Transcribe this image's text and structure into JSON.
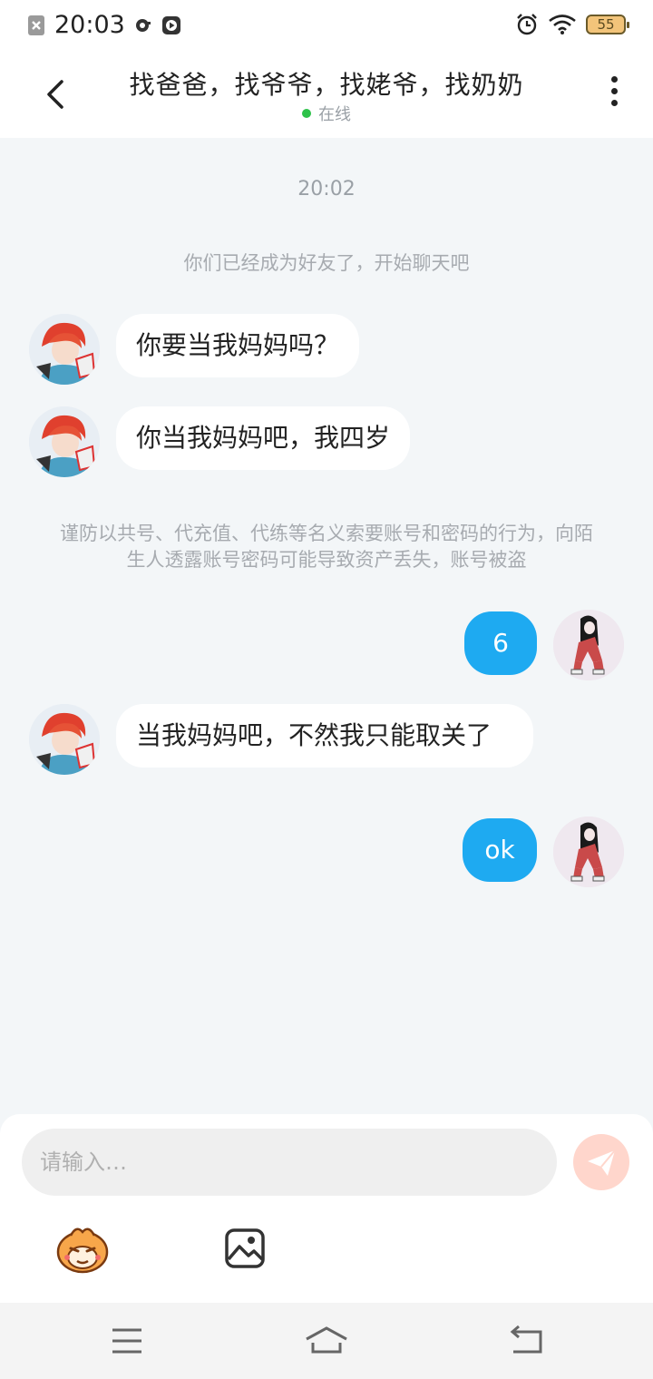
{
  "status_bar": {
    "time": "20:03",
    "battery": "55",
    "icons": [
      "notification-close-icon",
      "headset-icon",
      "media-play-icon",
      "alarm-icon",
      "wifi-icon",
      "battery-icon"
    ]
  },
  "header": {
    "title": "找爸爸，找爷爷，找姥爷，找奶奶",
    "status": "在线",
    "back_icon": "back-arrow-icon",
    "more_icon": "more-vertical-icon"
  },
  "chat": {
    "timestamp": "20:02",
    "system_note": "你们已经成为好友了，开始聊天吧",
    "warning_note": "谨防以共号、代充值、代练等名义索要账号和密码的行为，向陌生人透露账号密码可能导致资产丢失，账号被盗",
    "messages": [
      {
        "side": "left",
        "text": "你要当我妈妈吗？"
      },
      {
        "side": "left",
        "text": "你当我妈妈吧，我四岁"
      },
      {
        "side": "right",
        "text": "6"
      },
      {
        "side": "left",
        "text": "当我妈妈吧，不然我只能取关了"
      },
      {
        "side": "right",
        "text": "ok"
      }
    ]
  },
  "composer": {
    "placeholder": "请输入…",
    "send_icon": "send-plane-icon",
    "emoji_icon": "emoji-sticker-icon",
    "image_icon": "image-icon"
  },
  "nav_bar": {
    "icons": [
      "menu-icon",
      "home-icon",
      "back-icon"
    ]
  },
  "colors": {
    "accent_bubble": "#1eaaf1",
    "online_dot": "#2ec24a",
    "send_button": "#ffd6cc",
    "chat_background": "#f3f6f8"
  }
}
